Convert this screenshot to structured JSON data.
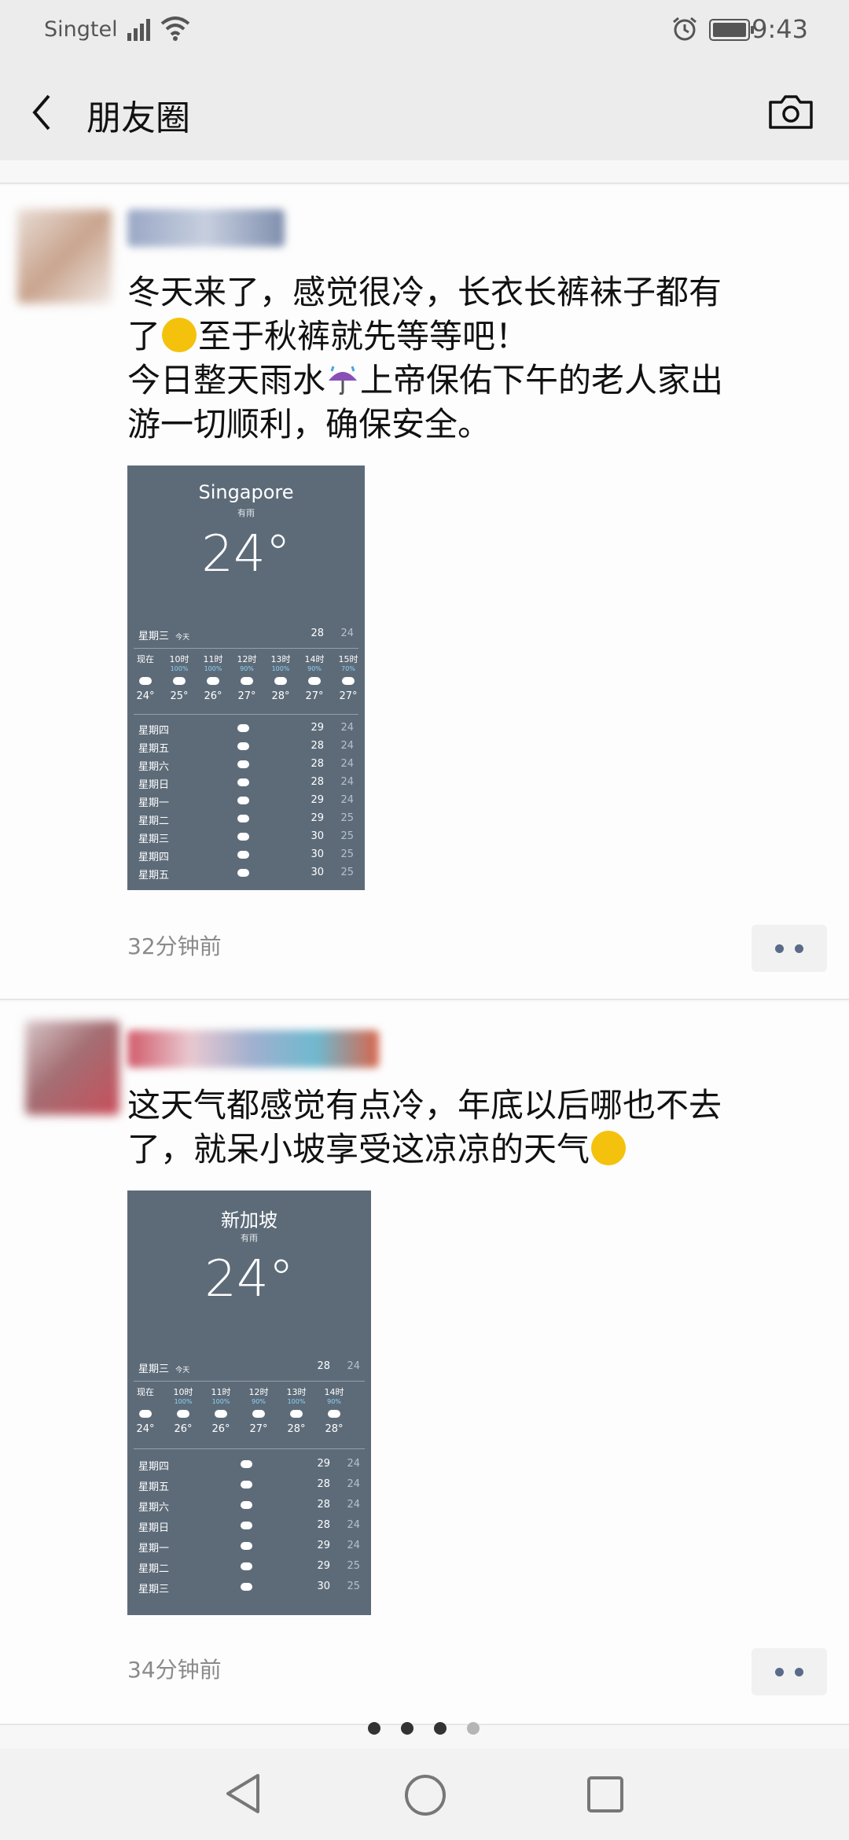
{
  "status_bar": {
    "carrier": "Singtel",
    "time": "9:43"
  },
  "nav_bar": {
    "title": "朋友圈"
  },
  "posts": [
    {
      "lines": [
        "冬天来了，感觉很冷，长衣长裤袜子都有",
        "了",
        "至于秋裤就先等等吧！",
        "今日整天雨水",
        "上帝保佑下午的老人家出",
        "游一切顺利，确保安全。"
      ],
      "timestamp": "32分钟前",
      "weather": {
        "city": "Singapore",
        "condition": "有雨",
        "temperature": "24°",
        "today": "星期三",
        "today_tag": "今天",
        "today_hi": "28",
        "today_lo": "24",
        "hours": [
          {
            "label": "现在",
            "pct": "",
            "temp": "24°"
          },
          {
            "label": "10时",
            "pct": "100%",
            "temp": "25°"
          },
          {
            "label": "11时",
            "pct": "100%",
            "temp": "26°"
          },
          {
            "label": "12时",
            "pct": "90%",
            "temp": "27°"
          },
          {
            "label": "13时",
            "pct": "100%",
            "temp": "28°"
          },
          {
            "label": "14时",
            "pct": "90%",
            "temp": "27°"
          },
          {
            "label": "15时",
            "pct": "70%",
            "temp": "27°"
          }
        ],
        "days": [
          {
            "name": "星期四",
            "hi": "29",
            "lo": "24"
          },
          {
            "name": "星期五",
            "hi": "28",
            "lo": "24"
          },
          {
            "name": "星期六",
            "hi": "28",
            "lo": "24"
          },
          {
            "name": "星期日",
            "hi": "28",
            "lo": "24"
          },
          {
            "name": "星期一",
            "hi": "29",
            "lo": "24"
          },
          {
            "name": "星期二",
            "hi": "29",
            "lo": "25"
          },
          {
            "name": "星期三",
            "hi": "30",
            "lo": "25"
          },
          {
            "name": "星期四",
            "hi": "30",
            "lo": "25"
          },
          {
            "name": "星期五",
            "hi": "30",
            "lo": "25"
          }
        ]
      }
    },
    {
      "lines": [
        "这天气都感觉有点冷，年底以后哪也不去",
        "了，就呆小坡享受这凉凉的天气"
      ],
      "timestamp": "34分钟前",
      "weather": {
        "city": "新加坡",
        "condition": "有雨",
        "temperature": "24°",
        "today": "星期三",
        "today_tag": "今天",
        "today_hi": "28",
        "today_lo": "24",
        "hours": [
          {
            "label": "现在",
            "pct": "",
            "temp": "24°"
          },
          {
            "label": "10时",
            "pct": "100%",
            "temp": "26°"
          },
          {
            "label": "11时",
            "pct": "100%",
            "temp": "26°"
          },
          {
            "label": "12时",
            "pct": "90%",
            "temp": "27°"
          },
          {
            "label": "13时",
            "pct": "100%",
            "temp": "28°"
          },
          {
            "label": "14时",
            "pct": "90%",
            "temp": "28°"
          }
        ],
        "days": [
          {
            "name": "星期四",
            "hi": "29",
            "lo": "24"
          },
          {
            "name": "星期五",
            "hi": "28",
            "lo": "24"
          },
          {
            "name": "星期六",
            "hi": "28",
            "lo": "24"
          },
          {
            "name": "星期日",
            "hi": "28",
            "lo": "24"
          },
          {
            "name": "星期一",
            "hi": "29",
            "lo": "24"
          },
          {
            "name": "星期二",
            "hi": "29",
            "lo": "25"
          },
          {
            "name": "星期三",
            "hi": "30",
            "lo": "25"
          }
        ]
      }
    }
  ],
  "icons": {
    "back": "chevron-left-icon",
    "camera": "camera-icon",
    "thinking_emoji": "thinking-face-emoji",
    "umbrella_emoji": "umbrella-rain-emoji",
    "more": "more-dots-icon"
  },
  "colors": {
    "weather_bg": "#5d6b79",
    "link": "#5a6b8a",
    "status_bg": "#ececec"
  }
}
